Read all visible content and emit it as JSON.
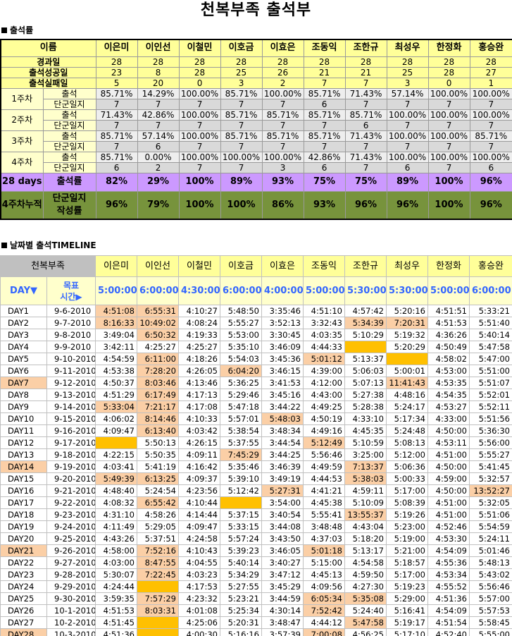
{
  "title": "천복부족 출석부",
  "sections": {
    "attendance": "출석률",
    "timeline": "날짜별 출석TIMELINE"
  },
  "names": [
    "이은미",
    "이인선",
    "이철민",
    "이호금",
    "이효은",
    "조동익",
    "조한규",
    "최성우",
    "한정화",
    "홍승완"
  ],
  "summary": {
    "name_label": "이름",
    "rows": [
      {
        "label": "경과일",
        "values": [
          "28",
          "28",
          "28",
          "28",
          "28",
          "28",
          "28",
          "28",
          "28",
          "28"
        ]
      },
      {
        "label": "출석성공일",
        "values": [
          "23",
          "8",
          "28",
          "25",
          "26",
          "21",
          "21",
          "25",
          "28",
          "27"
        ]
      },
      {
        "label": "출석실패일",
        "values": [
          "5",
          "20",
          "0",
          "3",
          "2",
          "7",
          "7",
          "3",
          "0",
          "1"
        ]
      }
    ]
  },
  "weeks": [
    {
      "label": "1주차",
      "att_label": "출석",
      "log_label": "단군일지",
      "att": [
        "85.71%",
        "14.29%",
        "100.00%",
        "85.71%",
        "100.00%",
        "85.71%",
        "71.43%",
        "57.14%",
        "100.00%",
        "100.00%"
      ],
      "log": [
        "7",
        "7",
        "7",
        "7",
        "7",
        "6",
        "7",
        "7",
        "7",
        "7"
      ]
    },
    {
      "label": "2주차",
      "att_label": "출석",
      "log_label": "단군일지",
      "att": [
        "71.43%",
        "42.86%",
        "100.00%",
        "85.71%",
        "85.71%",
        "85.71%",
        "85.71%",
        "100.00%",
        "100.00%",
        "100.00%"
      ],
      "log": [
        "7",
        "7",
        "7",
        "7",
        "7",
        "7",
        "6",
        "7",
        "7",
        "7"
      ]
    },
    {
      "label": "3주차",
      "att_label": "출석",
      "log_label": "단군일지",
      "att": [
        "85.71%",
        "57.14%",
        "100.00%",
        "85.71%",
        "85.71%",
        "85.71%",
        "71.43%",
        "100.00%",
        "100.00%",
        "85.71%"
      ],
      "log": [
        "7",
        "6",
        "7",
        "7",
        "7",
        "7",
        "7",
        "7",
        "7",
        "7"
      ]
    },
    {
      "label": "4주차",
      "att_label": "출석",
      "log_label": "단군일지",
      "att": [
        "85.71%",
        "0.00%",
        "100.00%",
        "100.00%",
        "100.00%",
        "42.86%",
        "71.43%",
        "100.00%",
        "100.00%",
        "100.00%"
      ],
      "log": [
        "6",
        "2",
        "7",
        "7",
        "3",
        "6",
        "7",
        "6",
        "7",
        "6"
      ]
    }
  ],
  "total": {
    "label": "28 days",
    "rate_label": "출석률",
    "values": [
      "82%",
      "29%",
      "100%",
      "89%",
      "93%",
      "75%",
      "75%",
      "89%",
      "100%",
      "96%"
    ]
  },
  "cumulative": {
    "label": "4주차누적",
    "rate_label_1": "단군일지",
    "rate_label_2": "작성률",
    "values": [
      "96%",
      "79%",
      "100%",
      "100%",
      "86%",
      "93%",
      "96%",
      "96%",
      "100%",
      "96%"
    ]
  },
  "timeline": {
    "corner_label": "천복부족",
    "day_label": "DAY▼",
    "goal_label_1": "목표",
    "goal_label_2": "시간▶",
    "goals": [
      "5:00:00",
      "6:00:00",
      "4:30:00",
      "6:00:00",
      "4:00:00",
      "5:00:00",
      "5:30:00",
      "5:30:00",
      "5:00:00",
      "6:00:00"
    ],
    "rows": [
      {
        "day": "DAY1",
        "date": "9-6-2010",
        "times": [
          "4:51:08",
          "6:55:31",
          "4:10:27",
          "5:48:50",
          "3:35:46",
          "4:51:10",
          "4:57:42",
          "5:20:16",
          "4:51:51",
          "5:33:21"
        ]
      },
      {
        "day": "DAY2",
        "date": "9-7-2010",
        "times": [
          "8:16:33",
          "10:49:02",
          "4:08:24",
          "5:55:27",
          "3:52:13",
          "3:32:43",
          "5:34:39",
          "7:20:31",
          "4:51:53",
          "5:51:40"
        ]
      },
      {
        "day": "DAY3",
        "date": "9-8-2010",
        "times": [
          "3:49:04",
          "6:50:32",
          "4:19:33",
          "5:53:00",
          "3:30:45",
          "4:03:35",
          "5:10:29",
          "5:19:32",
          "4:36:26",
          "5:40:14"
        ]
      },
      {
        "day": "DAY4",
        "date": "9-9-2010",
        "times": [
          "3:42:11",
          "4:25:27",
          "4:25:27",
          "5:35:10",
          "3:46:09",
          "4:44:33",
          "",
          "5:20:29",
          "4:50:49",
          "5:47:58"
        ]
      },
      {
        "day": "DAY5",
        "date": "9-10-2010",
        "times": [
          "4:54:59",
          "6:11:00",
          "4:18:26",
          "5:54:03",
          "3:45:36",
          "5:01:12",
          "5:13:37",
          "",
          "4:58:02",
          "5:47:00"
        ]
      },
      {
        "day": "DAY6",
        "date": "9-11-2010",
        "times": [
          "4:53:38",
          "7:28:20",
          "4:26:05",
          "6:04:20",
          "3:46:15",
          "4:39:00",
          "5:06:03",
          "5:00:01",
          "4:53:00",
          "5:51:00"
        ]
      },
      {
        "day": "DAY7",
        "date": "9-12-2010",
        "times": [
          "4:50:37",
          "8:03:46",
          "4:13:46",
          "5:36:25",
          "3:41:53",
          "4:12:00",
          "5:07:13",
          "11:41:43",
          "4:53:35",
          "5:51:07"
        ]
      },
      {
        "day": "DAY8",
        "date": "9-13-2010",
        "times": [
          "4:51:29",
          "6:17:49",
          "4:17:13",
          "5:29:46",
          "3:45:16",
          "4:43:00",
          "5:27:38",
          "4:48:16",
          "4:54:35",
          "5:52:01"
        ]
      },
      {
        "day": "DAY9",
        "date": "9-14-2010",
        "times": [
          "5:33:04",
          "7:21:17",
          "4:17:08",
          "5:47:18",
          "3:44:22",
          "4:49:25",
          "5:28:38",
          "5:24:17",
          "4:53:27",
          "5:52:11"
        ]
      },
      {
        "day": "DAY10",
        "date": "9-15-2010",
        "times": [
          "4:06:02",
          "8:14:46",
          "4:10:33",
          "5:57:01",
          "5:48:03",
          "4:50:19",
          "4:33:10",
          "5:17:34",
          "4:33:00",
          "5:51:56"
        ]
      },
      {
        "day": "DAY11",
        "date": "9-16-2010",
        "times": [
          "4:09:47",
          "6:13:40",
          "4:03:42",
          "5:38:54",
          "3:48:34",
          "4:49:16",
          "4:45:35",
          "5:24:48",
          "4:50:00",
          "5:36:30"
        ]
      },
      {
        "day": "DAY12",
        "date": "9-17-2010",
        "times": [
          "",
          "5:50:13",
          "4:26:15",
          "5:37:55",
          "3:44:54",
          "5:12:49",
          "5:10:59",
          "5:08:13",
          "4:53:11",
          "5:56:00"
        ]
      },
      {
        "day": "DAY13",
        "date": "9-18-2010",
        "times": [
          "4:22:15",
          "5:50:35",
          "4:09:11",
          "7:45:29",
          "3:44:25",
          "5:56:46",
          "3:25:00",
          "5:12:00",
          "4:51:00",
          "5:55:27"
        ]
      },
      {
        "day": "DAY14",
        "date": "9-19-2010",
        "times": [
          "4:03:41",
          "5:41:19",
          "4:16:42",
          "5:35:46",
          "3:46:39",
          "4:49:59",
          "7:13:37",
          "5:06:36",
          "4:50:00",
          "5:41:45"
        ]
      },
      {
        "day": "DAY15",
        "date": "9-20-2010",
        "times": [
          "5:49:39",
          "6:13:25",
          "4:09:37",
          "5:39:10",
          "3:49:19",
          "4:44:53",
          "5:38:03",
          "5:00:33",
          "4:59:00",
          "5:32:57"
        ]
      },
      {
        "day": "DAY16",
        "date": "9-21-2010",
        "times": [
          "4:48:40",
          "5:24:54",
          "4:23:56",
          "5:12:42",
          "5:27:31",
          "4:41:21",
          "4:59:11",
          "5:17:00",
          "4:50:00",
          "13:52:27"
        ]
      },
      {
        "day": "DAY17",
        "date": "9-22-2010",
        "times": [
          "4:08:32",
          "6:55:42",
          "4:10:44",
          "",
          "3:54:00",
          "4:45:38",
          "5:10:09",
          "5:08:39",
          "4:51:00",
          "5:32:05"
        ]
      },
      {
        "day": "DAY18",
        "date": "9-23-2010",
        "times": [
          "4:31:10",
          "4:58:26",
          "4:14:44",
          "5:37:15",
          "3:40:54",
          "5:55:41",
          "13:55:37",
          "5:19:26",
          "4:51:00",
          "5:51:06"
        ]
      },
      {
        "day": "DAY19",
        "date": "9-24-2010",
        "times": [
          "4:11:49",
          "5:29:05",
          "4:09:47",
          "5:33:15",
          "3:44:08",
          "3:48:48",
          "4:43:04",
          "5:23:00",
          "4:52:46",
          "5:54:59"
        ]
      },
      {
        "day": "DAY20",
        "date": "9-25-2010",
        "times": [
          "4:43:26",
          "5:37:51",
          "4:24:58",
          "5:57:24",
          "3:43:50",
          "4:37:03",
          "5:18:20",
          "5:19:00",
          "4:53:30",
          "5:24:11"
        ]
      },
      {
        "day": "DAY21",
        "date": "9-26-2010",
        "times": [
          "4:58:00",
          "7:52:16",
          "4:10:43",
          "5:39:23",
          "3:46:05",
          "5:01:18",
          "5:13:17",
          "5:21:00",
          "4:54:09",
          "5:01:46"
        ]
      },
      {
        "day": "DAY22",
        "date": "9-27-2010",
        "times": [
          "4:03:00",
          "8:47:55",
          "4:04:55",
          "5:40:14",
          "3:40:27",
          "5:15:00",
          "4:54:58",
          "5:18:57",
          "4:55:36",
          "5:48:13"
        ]
      },
      {
        "day": "DAY23",
        "date": "9-28-2010",
        "times": [
          "5:30:07",
          "7:22:45",
          "4:03:23",
          "5:34:29",
          "3:47:12",
          "4:45:13",
          "4:59:50",
          "5:17:00",
          "4:53:34",
          "5:43:02"
        ]
      },
      {
        "day": "DAY24",
        "date": "9-29-2010",
        "times": [
          "4:24:44",
          "",
          "4:17:53",
          "5:27:55",
          "3:45:29",
          "4:09:56",
          "4:27:30",
          "5:19:23",
          "4:55:52",
          "5:56:46"
        ]
      },
      {
        "day": "DAY25",
        "date": "9-30-2010",
        "times": [
          "3:59:35",
          "7:57:29",
          "4:23:32",
          "5:23:21",
          "3:44:59",
          "6:05:34",
          "5:35:08",
          "5:29:00",
          "4:51:36",
          "5:57:00"
        ]
      },
      {
        "day": "DAY26",
        "date": "10-1-2010",
        "times": [
          "4:51:53",
          "8:03:31",
          "4:01:08",
          "5:25:34",
          "4:30:14",
          "7:52:42",
          "5:24:40",
          "5:16:41",
          "4:54:09",
          "5:57:53"
        ]
      },
      {
        "day": "DAY27",
        "date": "10-2-2010",
        "times": [
          "4:51:45",
          "",
          "4:25:06",
          "5:20:31",
          "3:48:47",
          "4:44:12",
          "5:47:58",
          "5:19:17",
          "4:51:54",
          "5:58:45"
        ]
      },
      {
        "day": "DAY28",
        "date": "10-3-2010",
        "times": [
          "4:51:36",
          "",
          "4:00:30",
          "5:16:16",
          "3:57:39",
          "7:00:08",
          "4:56:25",
          "5:17:10",
          "4:52:40",
          "5:55:00"
        ]
      }
    ],
    "highlighted_days": [
      "DAY7",
      "DAY14",
      "DAY21",
      "DAY28"
    ],
    "late_cells": [
      [
        1,
        0
      ],
      [
        1,
        1
      ],
      [
        2,
        0
      ],
      [
        2,
        1
      ],
      [
        2,
        6
      ],
      [
        2,
        7
      ],
      [
        3,
        1
      ],
      [
        5,
        1
      ],
      [
        5,
        5
      ],
      [
        6,
        1
      ],
      [
        6,
        3
      ],
      [
        7,
        1
      ],
      [
        7,
        7
      ],
      [
        8,
        1
      ],
      [
        9,
        0
      ],
      [
        9,
        1
      ],
      [
        10,
        1
      ],
      [
        10,
        4
      ],
      [
        11,
        1
      ],
      [
        12,
        5
      ],
      [
        13,
        3
      ],
      [
        14,
        6
      ],
      [
        15,
        0
      ],
      [
        15,
        1
      ],
      [
        15,
        6
      ],
      [
        16,
        4
      ],
      [
        16,
        9
      ],
      [
        17,
        1
      ],
      [
        18,
        6
      ],
      [
        21,
        1
      ],
      [
        21,
        5
      ],
      [
        22,
        1
      ],
      [
        23,
        1
      ],
      [
        25,
        1
      ],
      [
        25,
        5
      ],
      [
        25,
        6
      ],
      [
        26,
        1
      ],
      [
        26,
        5
      ],
      [
        27,
        6
      ],
      [
        28,
        5
      ]
    ],
    "missing_cells": [
      [
        4,
        6
      ],
      [
        5,
        7
      ],
      [
        12,
        0
      ],
      [
        17,
        3
      ],
      [
        24,
        1
      ],
      [
        27,
        1
      ],
      [
        28,
        1
      ]
    ],
    "colors": {
      "late": "#fbcfa6",
      "missing": "#ffc000",
      "goal_text": "#3366ff"
    }
  }
}
